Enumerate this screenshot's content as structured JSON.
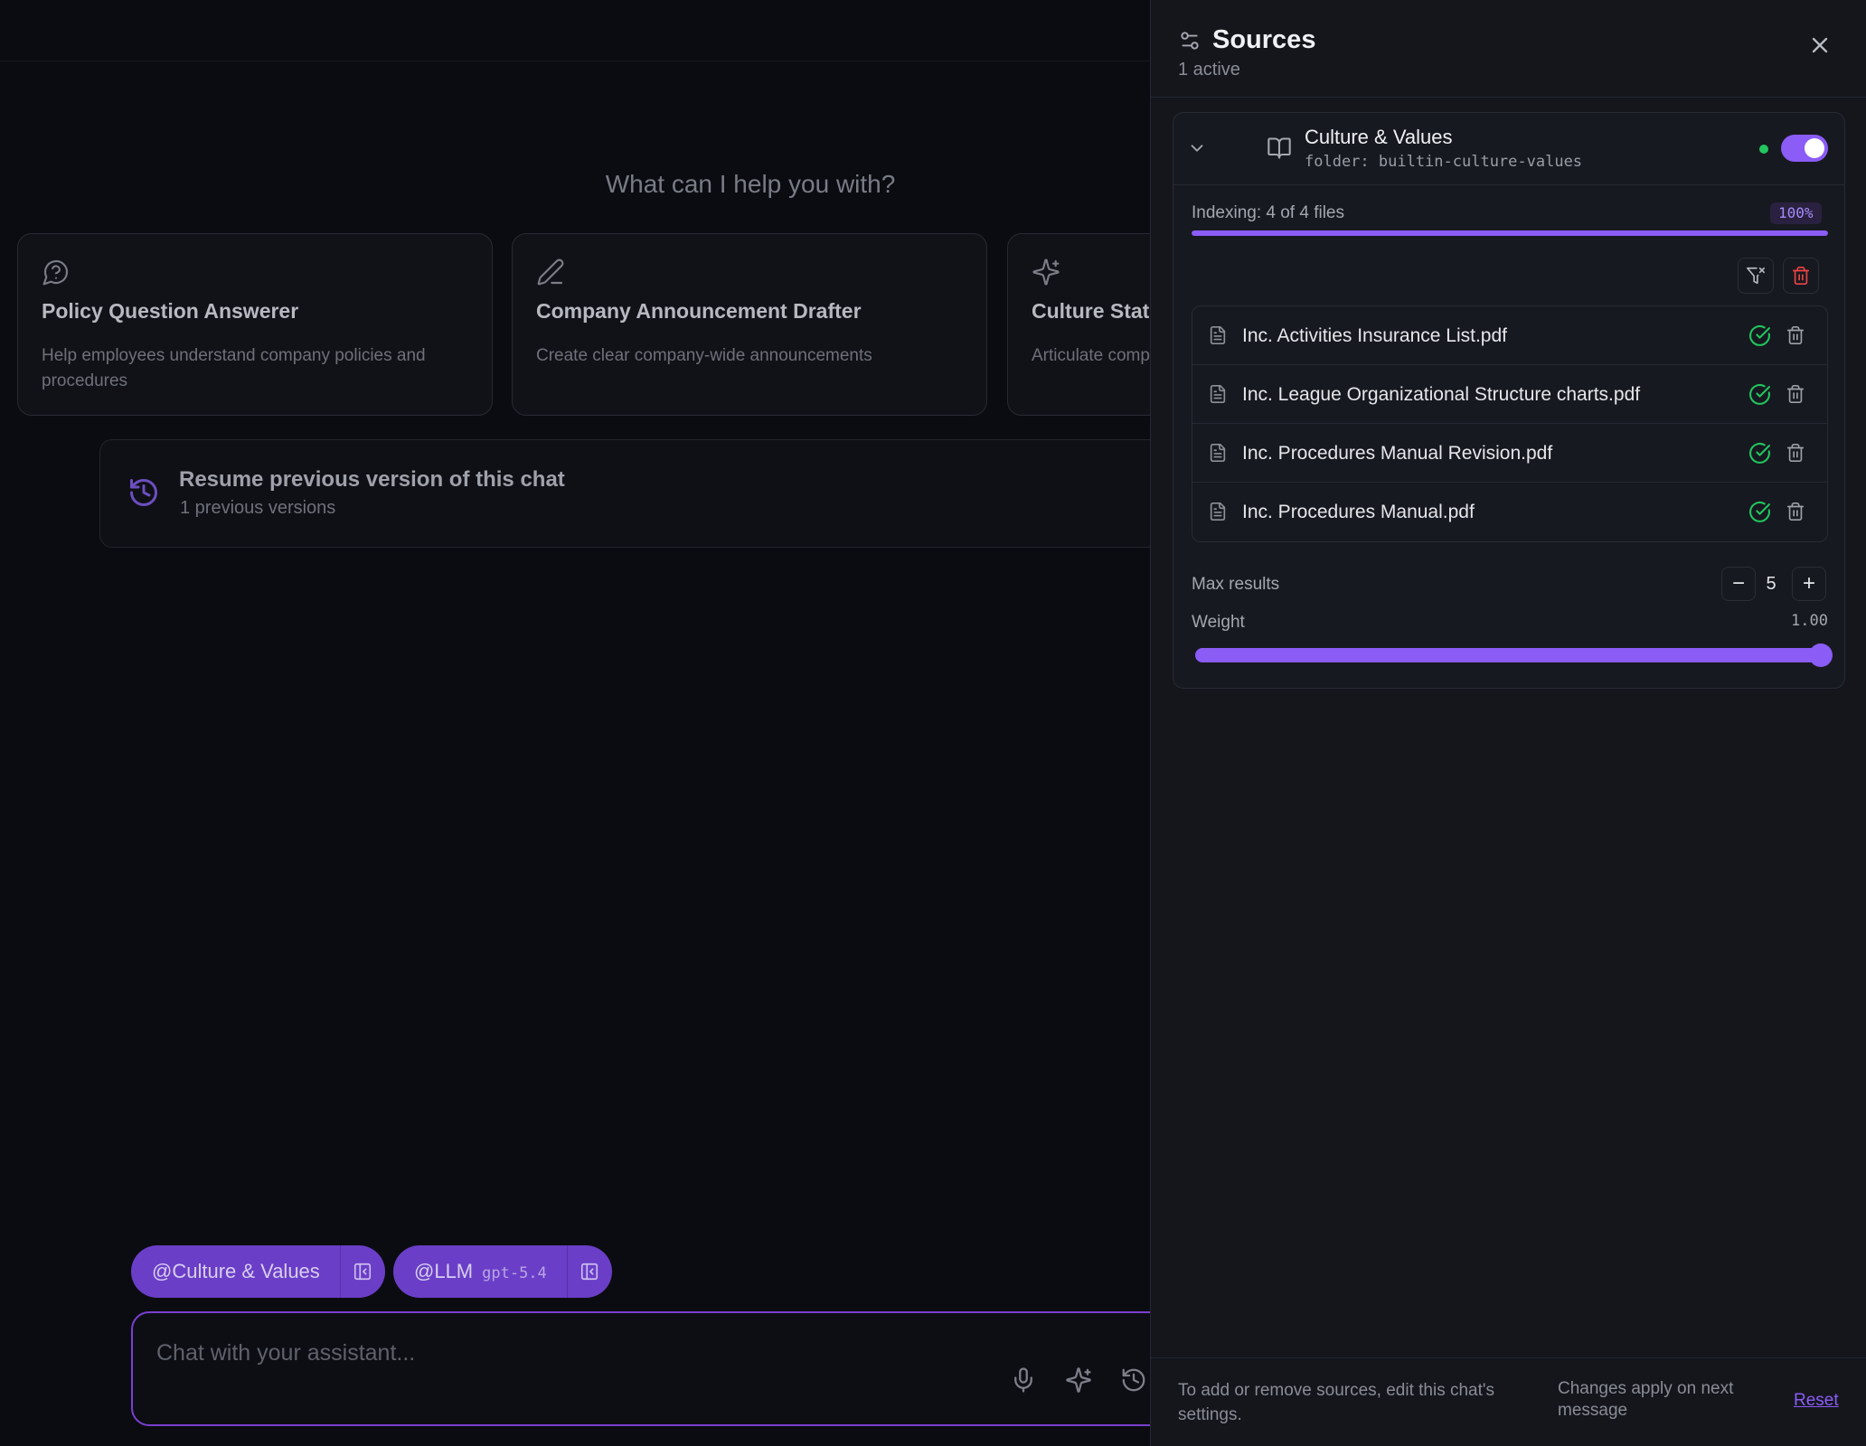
{
  "main": {
    "hero_title": "What can I help you with?",
    "cards": [
      {
        "title": "Policy Question Answerer",
        "desc": "Help employees understand company policies and procedures",
        "icon": "question-bubble-icon"
      },
      {
        "title": "Company Announcement Drafter",
        "desc": "Create clear company-wide announcements",
        "icon": "pen-icon"
      },
      {
        "title": "Culture Stat",
        "desc": "Articulate comp",
        "icon": "sparkles-icon"
      }
    ],
    "resume": {
      "title": "Resume previous version of this chat",
      "subtitle": "1 previous versions"
    },
    "chips": [
      {
        "label": "@Culture & Values",
        "model": ""
      },
      {
        "label": "@LLM",
        "model": "gpt-5.4"
      }
    ],
    "composer": {
      "placeholder": "Chat with your assistant..."
    }
  },
  "panel": {
    "title": "Sources",
    "subtitle": "1 active",
    "source": {
      "name": "Culture & Values",
      "folder": "folder: builtin-culture-values",
      "enabled": true,
      "status": "active"
    },
    "indexing": {
      "label": "Indexing: 4 of 4 files",
      "percent_label": "100%",
      "progress": 1.0
    },
    "files": [
      {
        "name": "Inc. Activities Insurance List.pdf",
        "status": "indexed"
      },
      {
        "name": "Inc. League Organizational Structure charts.pdf",
        "status": "indexed"
      },
      {
        "name": "Inc. Procedures Manual Revision.pdf",
        "status": "indexed"
      },
      {
        "name": "Inc. Procedures Manual.pdf",
        "status": "indexed"
      }
    ],
    "max_results": {
      "label": "Max results",
      "value": "5",
      "minus": "−",
      "plus": "+"
    },
    "weight": {
      "label": "Weight",
      "value": "1.00",
      "level": 1.0
    },
    "footer": {
      "note": "To add or remove sources, edit this chat's settings.",
      "apply_note": "Changes apply on next message",
      "reset_label": "Reset"
    }
  },
  "colors": {
    "accent": "#8b5cf6",
    "success": "#22c55e",
    "danger": "#ef4444",
    "panel_bg": "#14161c"
  }
}
